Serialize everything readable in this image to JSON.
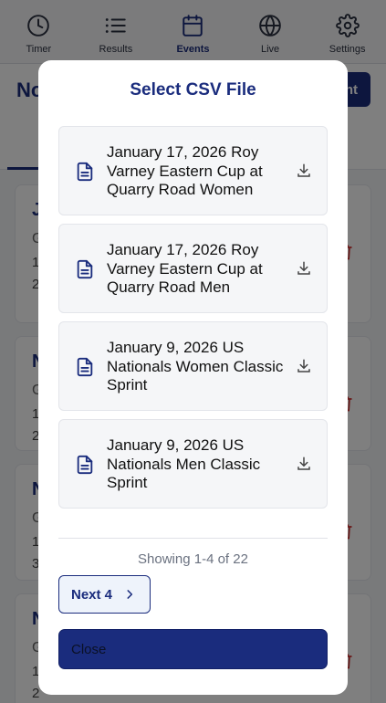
{
  "tabbar": {
    "items": [
      {
        "label": "Timer",
        "icon": "clock-icon"
      },
      {
        "label": "Results",
        "icon": "list-icon"
      },
      {
        "label": "Events",
        "icon": "calendar-icon",
        "active": true
      },
      {
        "label": "Live",
        "icon": "globe-icon"
      },
      {
        "label": "Settings",
        "icon": "gear-icon"
      }
    ]
  },
  "header": {
    "title_partial": "No",
    "button_partial": "nt"
  },
  "cards": [
    {
      "n": "J",
      "g": "G",
      "l1": "1",
      "l2": "2"
    },
    {
      "n": "N",
      "g": "G",
      "l1": "1",
      "l2": "2"
    },
    {
      "n": "N",
      "g": "G",
      "l1": "1",
      "l2": "3"
    },
    {
      "n": "N",
      "g": "G",
      "l1": "1",
      "l2": "2"
    }
  ],
  "modal": {
    "title": "Select CSV File",
    "files": [
      {
        "name": "January 17, 2026 Roy Varney Eastern Cup at Quarry Road Women"
      },
      {
        "name": "January 17, 2026 Roy Varney Eastern Cup at Quarry Road Men"
      },
      {
        "name": "January 9, 2026 US Nationals Women Classic Sprint"
      },
      {
        "name": "January 9, 2026 US Nationals Men Classic Sprint"
      }
    ],
    "showing": "Showing 1-4 of 22",
    "next_label": "Next 4",
    "close_label": "Close"
  },
  "colors": {
    "accent": "#1a2c7d",
    "danger": "#d32f2f"
  }
}
